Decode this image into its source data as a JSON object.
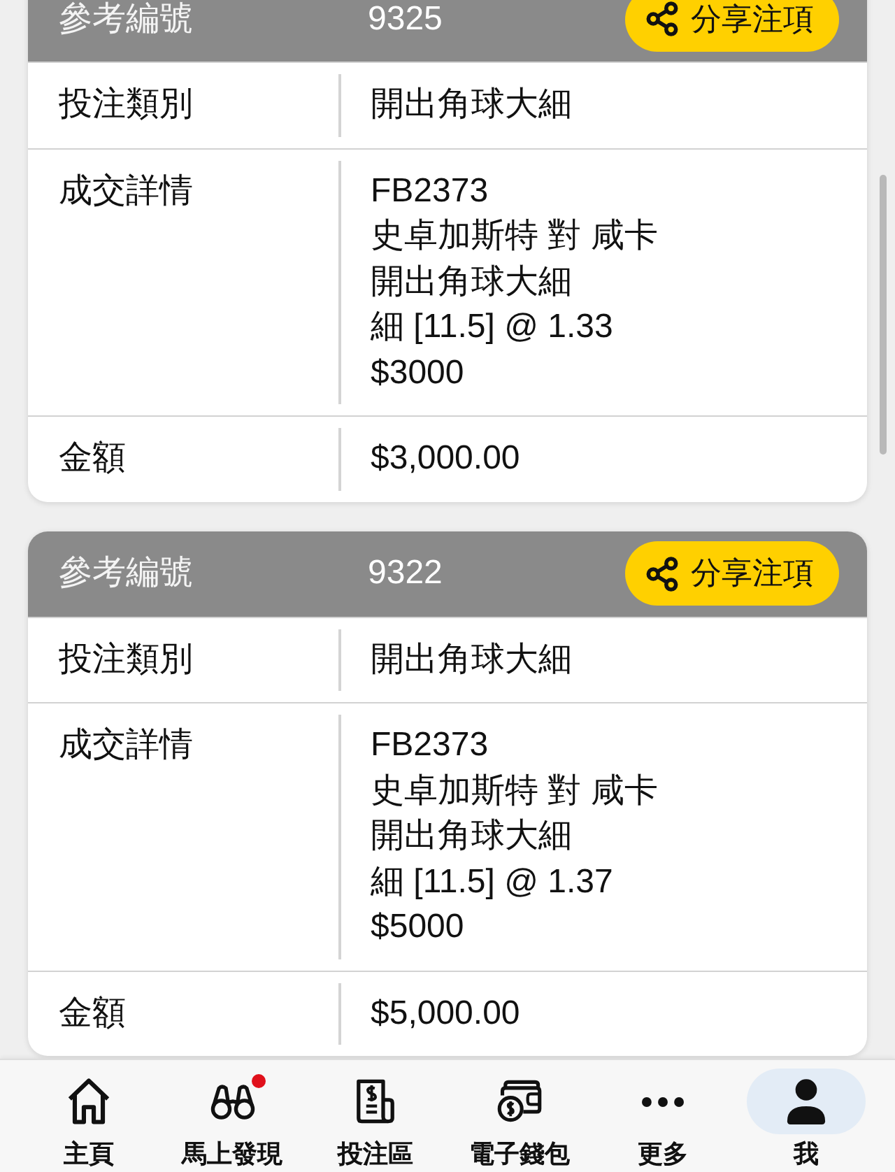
{
  "bets": [
    {
      "ref_label": "參考編號",
      "ref_number": "9325",
      "share_button": "分享注項",
      "rows": [
        {
          "label": "投注類別",
          "lines": [
            "開出角球大細"
          ]
        },
        {
          "label": "成交詳情",
          "lines": [
            "FB2373",
            "史卓加斯特 對 咸卡",
            "開出角球大細",
            "細 [11.5] @ 1.33",
            "$3000"
          ]
        },
        {
          "label": "金額",
          "lines": [
            "$3,000.00"
          ]
        }
      ]
    },
    {
      "ref_label": "參考編號",
      "ref_number": "9322",
      "share_button": "分享注項",
      "rows": [
        {
          "label": "投注類別",
          "lines": [
            "開出角球大細"
          ]
        },
        {
          "label": "成交詳情",
          "lines": [
            "FB2373",
            "史卓加斯特 對 咸卡",
            "開出角球大細",
            "細 [11.5] @ 1.37",
            "$5000"
          ]
        },
        {
          "label": "金額",
          "lines": [
            "$5,000.00"
          ]
        }
      ]
    }
  ],
  "bottom_nav": [
    {
      "label": "主頁",
      "kind": "home",
      "badge": false,
      "selected": false
    },
    {
      "label": "馬上發現",
      "kind": "binoculars",
      "badge": true,
      "selected": false
    },
    {
      "label": "投注區",
      "kind": "document",
      "badge": false,
      "selected": false
    },
    {
      "label": "電子錢包",
      "kind": "wallet",
      "badge": false,
      "selected": false
    },
    {
      "label": "更多",
      "kind": "more",
      "badge": false,
      "selected": false
    },
    {
      "label": "我",
      "kind": "person",
      "badge": false,
      "selected": true
    }
  ]
}
